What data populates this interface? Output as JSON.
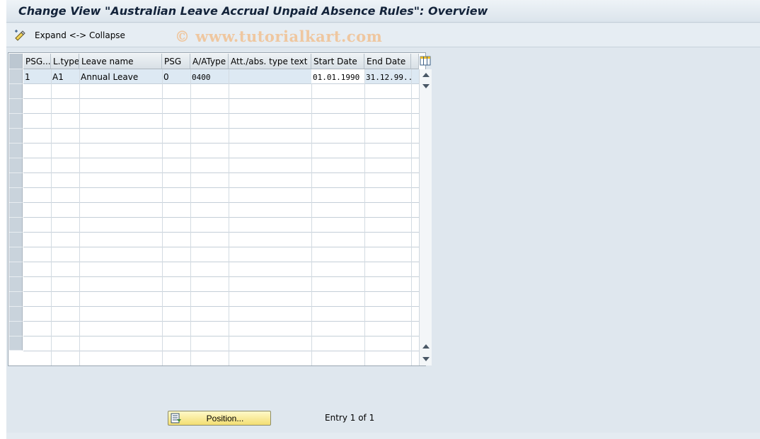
{
  "window": {
    "title": "Change View \"Australian Leave Accrual Unpaid Absence Rules\": Overview"
  },
  "toolbar": {
    "expand_collapse_label": "Expand <-> Collapse",
    "icon": "expand-collapse-icon"
  },
  "watermark": "© www.tutorialkart.com",
  "table": {
    "columns": [
      "PSG...",
      "L.type",
      "Leave name",
      "PSG",
      "A/AType",
      "Att./abs. type text",
      "Start Date",
      "End Date"
    ],
    "rows": [
      [
        "1",
        "A1",
        "Annual Leave",
        "0",
        "0400",
        "",
        "01.01.1990",
        "31.12.99..."
      ]
    ],
    "visible_row_count": 19,
    "column_settings_icon": "table-settings-icon"
  },
  "footer": {
    "position_button_label": "Position...",
    "position_icon": "position-icon",
    "entry_info": "Entry 1 of 1"
  },
  "colors": {
    "title_text": "#13233a",
    "button_yellow": "#f3de72",
    "selected_row": "#dde9f3",
    "watermark": "#efc7a0"
  }
}
